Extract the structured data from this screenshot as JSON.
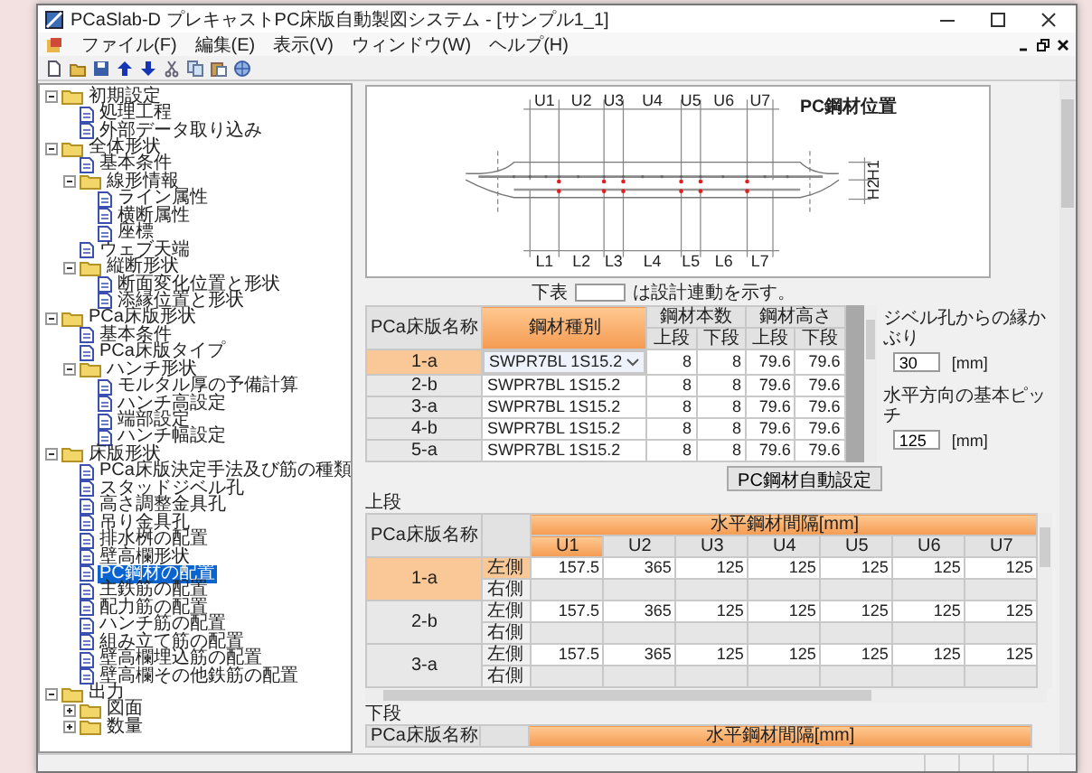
{
  "window": {
    "title": "PCaSlab-D プレキャストPC床版自動製図システム - [サンプル1_1]",
    "menus": [
      "ファイル(F)",
      "編集(E)",
      "表示(V)",
      "ウィンドウ(W)",
      "ヘルプ(H)"
    ]
  },
  "toolbar": [
    {
      "kind": "new"
    },
    {
      "kind": "open"
    },
    {
      "kind": "save"
    },
    {
      "kind": "up"
    },
    {
      "kind": "down"
    },
    {
      "kind": "cut"
    },
    {
      "kind": "copy"
    },
    {
      "kind": "paste"
    },
    {
      "kind": "globe"
    }
  ],
  "tree": [
    {
      "label": "初期設定",
      "kind": "folder",
      "expanded": true,
      "selected": false,
      "children": [
        {
          "label": "処理工程",
          "kind": "page",
          "selected": false
        },
        {
          "label": "外部データ取り込み",
          "kind": "page",
          "selected": false
        }
      ]
    },
    {
      "label": "全体形状",
      "kind": "folder",
      "expanded": true,
      "selected": false,
      "children": [
        {
          "label": "基本条件",
          "kind": "page",
          "selected": false
        },
        {
          "label": "線形情報",
          "kind": "folder",
          "expanded": true,
          "selected": false,
          "children": [
            {
              "label": "ライン属性",
              "kind": "page",
              "selected": false
            },
            {
              "label": "横断属性",
              "kind": "page",
              "selected": false
            },
            {
              "label": "座標",
              "kind": "page",
              "selected": false
            }
          ]
        },
        {
          "label": "ウェブ天端",
          "kind": "page",
          "selected": false
        },
        {
          "label": "縦断形状",
          "kind": "folder",
          "expanded": true,
          "selected": false,
          "children": [
            {
              "label": "断面変化位置と形状",
              "kind": "page",
              "selected": false
            },
            {
              "label": "添縁位置と形状",
              "kind": "page",
              "selected": false
            }
          ]
        }
      ]
    },
    {
      "label": "PCa床版形状",
      "kind": "folder",
      "expanded": true,
      "selected": false,
      "children": [
        {
          "label": "基本条件",
          "kind": "page",
          "selected": false
        },
        {
          "label": "PCa床版タイプ",
          "kind": "page",
          "selected": false
        },
        {
          "label": "ハンチ形状",
          "kind": "folder",
          "expanded": true,
          "selected": false,
          "children": [
            {
              "label": "モルタル厚の予備計算",
              "kind": "page",
              "selected": false
            },
            {
              "label": "ハンチ高設定",
              "kind": "page",
              "selected": false
            },
            {
              "label": "端部設定",
              "kind": "page",
              "selected": false
            },
            {
              "label": "ハンチ幅設定",
              "kind": "page",
              "selected": false
            }
          ]
        }
      ]
    },
    {
      "label": "床版形状",
      "kind": "folder",
      "expanded": true,
      "selected": false,
      "children": [
        {
          "label": "PCa床版決定手法及び筋の種類",
          "kind": "page",
          "selected": false
        },
        {
          "label": "スタッドジベル孔",
          "kind": "page",
          "selected": false
        },
        {
          "label": "高さ調整金具孔",
          "kind": "page",
          "selected": false
        },
        {
          "label": "吊り金具孔",
          "kind": "page",
          "selected": false
        },
        {
          "label": "排水桝の配置",
          "kind": "page",
          "selected": false
        },
        {
          "label": "壁高欄形状",
          "kind": "page",
          "selected": false
        },
        {
          "label": "PC鋼材の配置",
          "kind": "page",
          "selected": true
        },
        {
          "label": "主鉄筋の配置",
          "kind": "page",
          "selected": false
        },
        {
          "label": "配力筋の配置",
          "kind": "page",
          "selected": false
        },
        {
          "label": "ハンチ筋の配置",
          "kind": "page",
          "selected": false
        },
        {
          "label": "組み立て筋の配置",
          "kind": "page",
          "selected": false
        },
        {
          "label": "壁高欄埋込筋の配置",
          "kind": "page",
          "selected": false
        },
        {
          "label": "壁高欄その他鉄筋の配置",
          "kind": "page",
          "selected": false
        }
      ]
    },
    {
      "label": "出力",
      "kind": "folder",
      "expanded": true,
      "selected": false,
      "children": [
        {
          "label": "図面",
          "kind": "folder",
          "expanded": false,
          "selected": false
        },
        {
          "label": "数量",
          "kind": "folder",
          "expanded": false,
          "selected": false
        }
      ]
    }
  ],
  "diagram": {
    "title": "PC鋼材位置",
    "upper_labels": [
      "U1",
      "U2",
      "U3",
      "U4",
      "U5",
      "U6",
      "U7"
    ],
    "lower_labels": [
      "L1",
      "L2",
      "L3",
      "L4",
      "L5",
      "L6",
      "L7"
    ],
    "side_labels": [
      "H1",
      "H2"
    ]
  },
  "legend": {
    "prefix": "下表",
    "suffix": "は設計連動を示す。"
  },
  "strand_table": {
    "name_header": "PCa床版名称",
    "type_header": "鋼材種別",
    "groups": [
      {
        "label": "鋼材本数",
        "subs": [
          "上段",
          "下段"
        ]
      },
      {
        "label": "鋼材高さ",
        "subs": [
          "上段",
          "下段"
        ]
      }
    ],
    "rows": [
      {
        "name": "1-a",
        "selected": true,
        "type": "SWPR7BL 1S15.2",
        "dropdown": true,
        "values": [
          "8",
          "8",
          "79.6",
          "79.6"
        ]
      },
      {
        "name": "2-b",
        "selected": false,
        "type": "SWPR7BL 1S15.2",
        "dropdown": false,
        "values": [
          "8",
          "8",
          "79.6",
          "79.6"
        ]
      },
      {
        "name": "3-a",
        "selected": false,
        "type": "SWPR7BL 1S15.2",
        "dropdown": false,
        "values": [
          "8",
          "8",
          "79.6",
          "79.6"
        ]
      },
      {
        "name": "4-b",
        "selected": false,
        "type": "SWPR7BL 1S15.2",
        "dropdown": false,
        "values": [
          "8",
          "8",
          "79.6",
          "79.6"
        ]
      },
      {
        "name": "5-a",
        "selected": false,
        "type": "SWPR7BL 1S15.2",
        "dropdown": false,
        "values": [
          "8",
          "8",
          "79.6",
          "79.6"
        ]
      }
    ]
  },
  "fields": [
    {
      "label": "ジベル孔からの縁かぶり",
      "value": "30",
      "unit": "[mm]"
    },
    {
      "label": "水平方向の基本ピッチ",
      "value": "125",
      "unit": "[mm]"
    }
  ],
  "auto_button": "PC鋼材自動設定",
  "upper": {
    "title": "上段",
    "name_header": "PCa床版名称",
    "header": "水平鋼材間隔[mm]",
    "columns": [
      {
        "label": "U1",
        "selected": true
      },
      {
        "label": "U2",
        "selected": false
      },
      {
        "label": "U3",
        "selected": false
      },
      {
        "label": "U4",
        "selected": false
      },
      {
        "label": "U5",
        "selected": false
      },
      {
        "label": "U6",
        "selected": false
      },
      {
        "label": "U7",
        "selected": false
      }
    ],
    "rows": [
      {
        "name": "1-a",
        "selected": true,
        "sides": [
          {
            "label": "左側",
            "selected": true,
            "values": [
              "157.5",
              "365",
              "125",
              "125",
              "125",
              "125",
              "125"
            ]
          },
          {
            "label": "右側",
            "selected": false
          }
        ]
      },
      {
        "name": "2-b",
        "selected": false,
        "sides": [
          {
            "label": "左側",
            "selected": false,
            "values": [
              "157.5",
              "365",
              "125",
              "125",
              "125",
              "125",
              "125"
            ]
          },
          {
            "label": "右側",
            "selected": false
          }
        ]
      },
      {
        "name": "3-a",
        "selected": false,
        "sides": [
          {
            "label": "左側",
            "selected": false,
            "values": [
              "157.5",
              "365",
              "125",
              "125",
              "125",
              "125",
              "125"
            ]
          },
          {
            "label": "右側",
            "selected": false
          }
        ]
      }
    ]
  },
  "lower": {
    "title": "下段",
    "name_header": "PCa床版名称",
    "header": "水平鋼材間隔[mm]"
  }
}
